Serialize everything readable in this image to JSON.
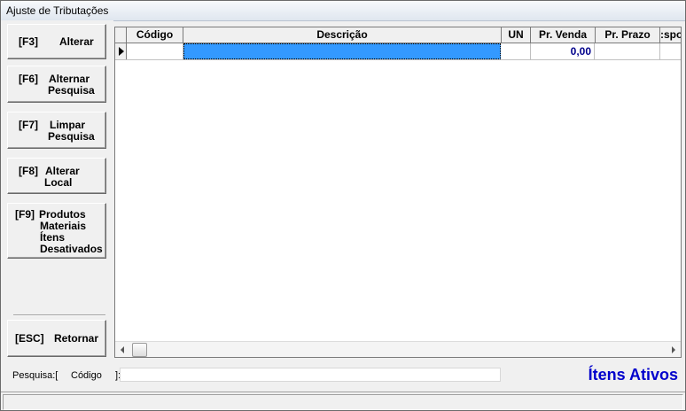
{
  "window": {
    "title": "Ajuste de Tributações"
  },
  "buttons": [
    {
      "key": "[F3]",
      "lines": [
        "Alterar"
      ]
    },
    {
      "key": "[F6]",
      "lines": [
        "Alternar",
        "Pesquisa"
      ]
    },
    {
      "key": "[F7]",
      "lines": [
        "Limpar",
        "Pesquisa"
      ]
    },
    {
      "key": "[F8]",
      "lines": [
        "Alterar",
        "Local"
      ]
    },
    {
      "key": "[F9]",
      "lines": [
        "Produtos",
        "Materiais",
        "Ítens",
        "Desativados"
      ]
    },
    {
      "key": "[ESC]",
      "lines": [
        "Retornar"
      ]
    }
  ],
  "grid": {
    "columns": [
      "Código",
      "Descrição",
      "UN",
      "Pr. Venda",
      "Pr. Prazo",
      ":spo"
    ],
    "rows": [
      {
        "codigo": "",
        "descricao": "",
        "un": "",
        "pr_venda": "0,00",
        "pr_prazo": "",
        "extra": ""
      }
    ]
  },
  "search": {
    "prefix": "Pesquisa:[",
    "field": "Código",
    "suffix": "]:",
    "value": ""
  },
  "status": {
    "label": "Ítens Ativos"
  }
}
